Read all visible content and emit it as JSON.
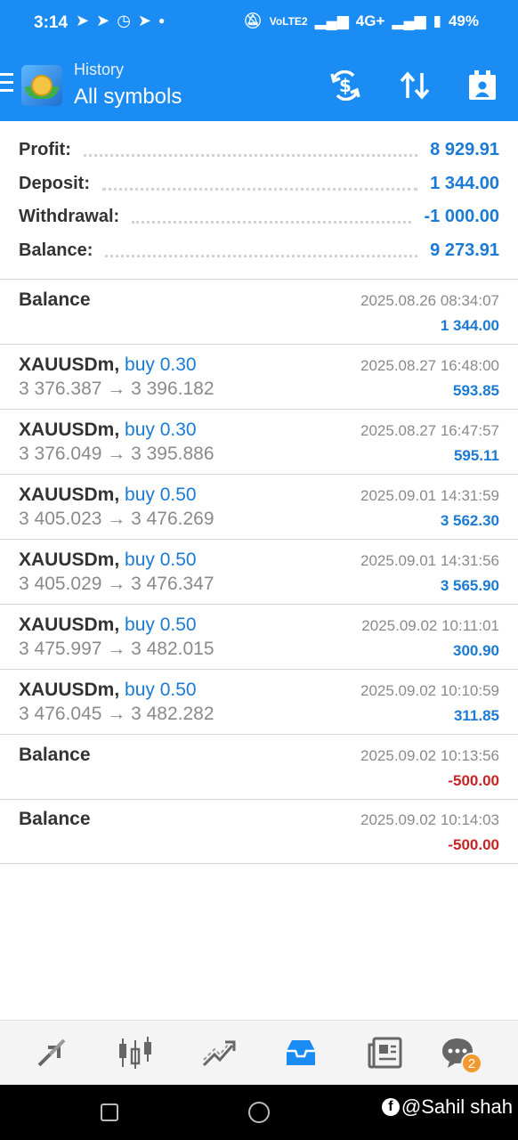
{
  "status_bar": {
    "time": "3:14",
    "battery": "49%",
    "network": "4G+",
    "volte": "VoLTE2"
  },
  "app_bar": {
    "subtitle": "History",
    "title": "All symbols",
    "icons": [
      "menu-icon",
      "metatrader-logo",
      "currency-exchange-icon",
      "sort-icon",
      "calendar-icon"
    ]
  },
  "summary": {
    "profit": {
      "label": "Profit:",
      "value": "8 929.91"
    },
    "deposit": {
      "label": "Deposit:",
      "value": "1 344.00"
    },
    "withdrawal": {
      "label": "Withdrawal:",
      "value": "-1 000.00"
    },
    "balance": {
      "label": "Balance:",
      "value": "9 273.91"
    }
  },
  "deals": [
    {
      "symbol": "Balance",
      "type": "",
      "prices": "",
      "time": "2025.08.26 08:34:07",
      "profit": "1 344.00",
      "negative": false
    },
    {
      "symbol": "XAUUSDm,",
      "type": "buy 0.30",
      "prices": "3 376.387 → 3 396.182",
      "time": "2025.08.27 16:48:00",
      "profit": "593.85",
      "negative": false
    },
    {
      "symbol": "XAUUSDm,",
      "type": "buy 0.30",
      "prices": "3 376.049 → 3 395.886",
      "time": "2025.08.27 16:47:57",
      "profit": "595.11",
      "negative": false
    },
    {
      "symbol": "XAUUSDm,",
      "type": "buy 0.50",
      "prices": "3 405.023 → 3 476.269",
      "time": "2025.09.01 14:31:59",
      "profit": "3 562.30",
      "negative": false
    },
    {
      "symbol": "XAUUSDm,",
      "type": "buy 0.50",
      "prices": "3 405.029 → 3 476.347",
      "time": "2025.09.01 14:31:56",
      "profit": "3 565.90",
      "negative": false
    },
    {
      "symbol": "XAUUSDm,",
      "type": "buy 0.50",
      "prices": "3 475.997 → 3 482.015",
      "time": "2025.09.02 10:11:01",
      "profit": "300.90",
      "negative": false
    },
    {
      "symbol": "XAUUSDm,",
      "type": "buy 0.50",
      "prices": "3 476.045 → 3 482.282",
      "time": "2025.09.02 10:10:59",
      "profit": "311.85",
      "negative": false
    },
    {
      "symbol": "Balance",
      "type": "",
      "prices": "",
      "time": "2025.09.02 10:13:56",
      "profit": "-500.00",
      "negative": true
    },
    {
      "symbol": "Balance",
      "type": "",
      "prices": "",
      "time": "2025.09.02 10:14:03",
      "profit": "-500.00",
      "negative": true
    }
  ],
  "bottom_nav": {
    "items": [
      "quotes-icon",
      "chart-icon",
      "trade-icon",
      "history-icon",
      "news-icon",
      "chat-icon"
    ],
    "active": "history-icon",
    "chat_badge": "2"
  },
  "watermark": "@Sahil shah",
  "colors": {
    "accent": "#1b8cf3",
    "positive": "#1a7ad4",
    "negative": "#c62424",
    "badge": "#f29a2e"
  }
}
